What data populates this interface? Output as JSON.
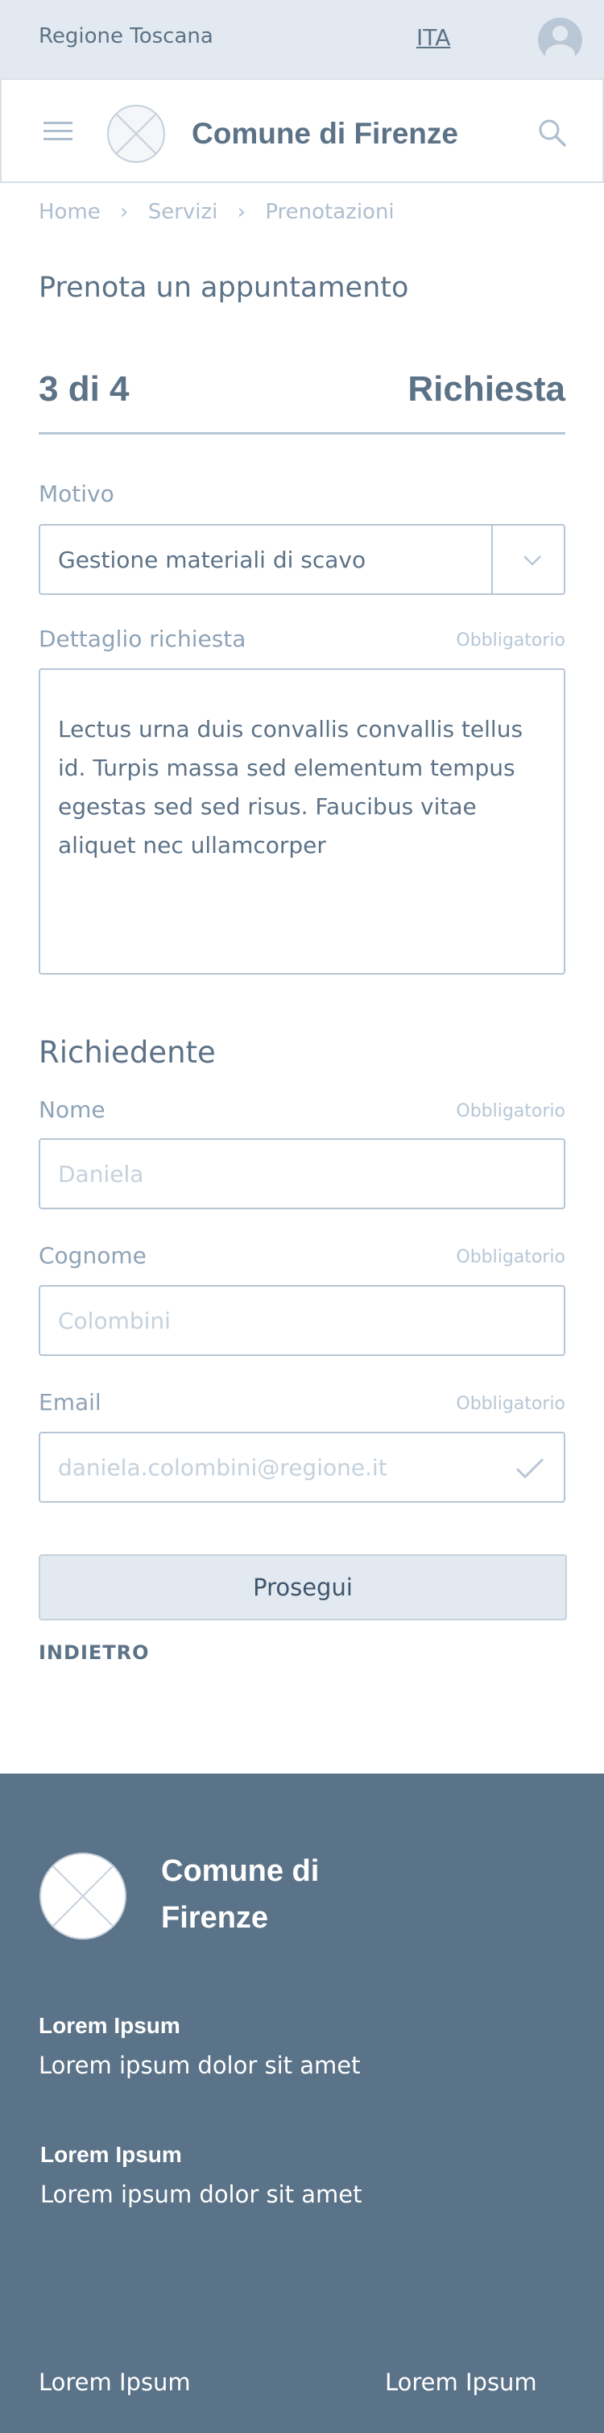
{
  "topbar": {
    "region": "Regione Toscana",
    "language": "ITA"
  },
  "header": {
    "brand": "Comune di Firenze"
  },
  "breadcrumb": [
    "Home",
    "Servizi",
    "Prenotazioni"
  ],
  "page": {
    "title": "Prenota un appuntamento"
  },
  "stepper": {
    "step": "3 di 4",
    "step_name": "Richiesta"
  },
  "form": {
    "motivo_label": "Motivo",
    "motivo_value": "Gestione materiali di scavo",
    "dettaglio_label": "Dettaglio richiesta",
    "required": "Obbligatorio",
    "dettaglio_value": "Lectus urna duis convallis convallis tellus id. Turpis massa sed elementum tempus egestas sed sed risus. Faucibus vitae aliquet nec ullamcorper",
    "richiedente_title": "Richiedente",
    "nome_label": "Nome",
    "nome_placeholder": "Daniela",
    "cognome_label": "Cognome",
    "cognome_placeholder": "Colombini",
    "email_label": "Email",
    "email_placeholder": "daniela.colombini@regione.it",
    "submit_label": "Prosegui",
    "back_label": "INDIETRO"
  },
  "footer": {
    "brand": "Comune di Firenze",
    "blocks": [
      {
        "heading": "Lorem Ipsum",
        "text": "Lorem ipsum dolor sit amet"
      },
      {
        "heading": "Lorem Ipsum",
        "text": "Lorem ipsum dolor sit amet"
      }
    ],
    "links": [
      "Lorem Ipsum",
      "Lorem Ipsum"
    ]
  },
  "colors": {
    "primary": "#5c7287",
    "muted": "#aebed0",
    "border": "#b7c6d6",
    "topbar_bg": "#e3e9f0",
    "footer_bg": "#5b7388"
  },
  "icons": [
    "user-avatar-icon",
    "hamburger-menu-icon",
    "logo-placeholder-icon",
    "search-icon",
    "chevron-right-icon",
    "chevron-down-icon",
    "checkmark-icon"
  ]
}
